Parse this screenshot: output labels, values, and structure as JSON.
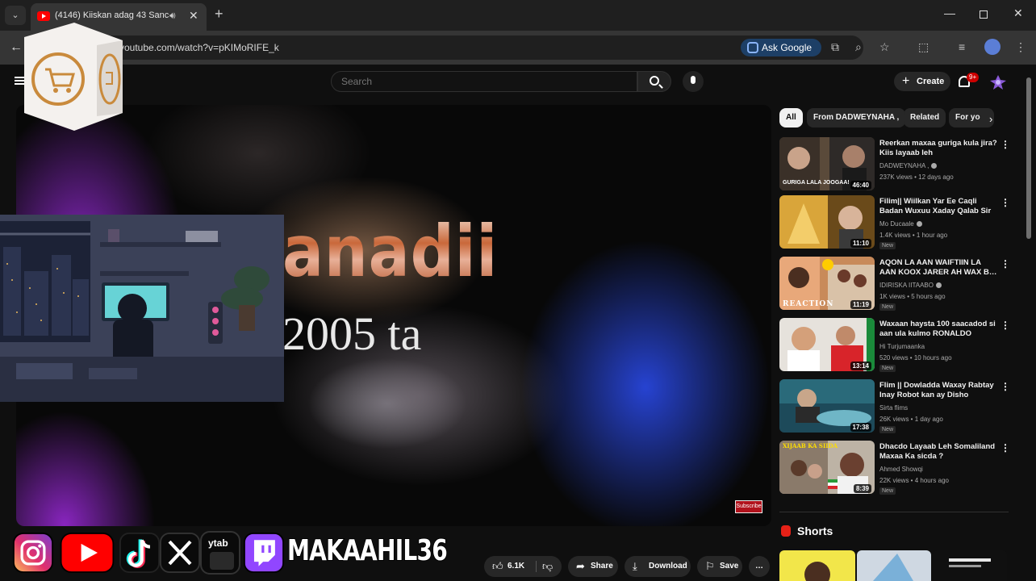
{
  "browser": {
    "tab_title": "(4146) Kiiskan adag 43 Sanc",
    "url": "youtube.com/watch?v=pKIMoRIFE_k",
    "ask_google_label": "Ask Google",
    "window_controls": [
      "minimize-icon",
      "restore-icon",
      "close-icon"
    ]
  },
  "header": {
    "search_placeholder": "Search",
    "create_label": "Create",
    "notification_badge": "9+"
  },
  "video": {
    "overlay_title": "anadii",
    "overlay_year": "2005 ta",
    "subscribe_badge": "Subscribe"
  },
  "actions": {
    "like_count": "6.1K",
    "share_label": "Share",
    "download_label": "Download",
    "save_label": "Save",
    "more_label": "…"
  },
  "social": {
    "handle": "MAKAAHIL36",
    "icons": [
      "instagram-icon",
      "youtube-icon",
      "tiktok-icon",
      "x-icon",
      "ytab-icon",
      "twitch-icon"
    ],
    "ytab_label": "ytab"
  },
  "sidebar": {
    "chips": [
      "All",
      "From DADWEYNAHA ,",
      "Related",
      "For yo"
    ],
    "recommendations": [
      {
        "title": "Reerkan maxaa guriga kula jira? Kiis layaab leh",
        "channel": "DADWEYNAHA ,",
        "verified": true,
        "meta": "237K views • 12 days ago",
        "duration": "46:40",
        "thumb_caption": "GURIGA LALA JOOGAA!",
        "is_new": false
      },
      {
        "title": "Filim|| Wiilkan Yar Ee Caqli Badan Wuxuu Xaday Qalab Sir …",
        "channel": "Mo Ducaale",
        "verified": true,
        "meta": "1.4K views • 1 hour ago",
        "duration": "11:10",
        "is_new": true
      },
      {
        "title": "AQON LA AAN WAIFTIIN LA AAN KOOX JARER AH WAX B…",
        "channel": "IDIRISKA IITAABO",
        "verified": true,
        "meta": "1K views • 5 hours ago",
        "duration": "11:19",
        "thumb_caption": "REACTION",
        "is_new": true
      },
      {
        "title": "Waxaan haysta 100 saacadod si aan ula kulmo  RONALDO",
        "channel": "Hi Turjumaanka",
        "verified": false,
        "meta": "520 views • 10 hours ago",
        "duration": "13:14",
        "is_new": true
      },
      {
        "title": "Flim || Dowladda Waxay Rabtay Inay Robot  kan ay Disho Laakii…",
        "channel": "Sirta flims",
        "verified": false,
        "meta": "26K views • 1 day ago",
        "duration": "17:38",
        "is_new": true
      },
      {
        "title": "Dhacdo Layaab Leh Somaliland Maxaa Ka sicda ?",
        "channel": "Ahmed Showqi",
        "verified": false,
        "meta": "22K views • 4 hours ago",
        "duration": "8:39",
        "thumb_caption": "XIJAAB KA SIIDA",
        "is_new": true
      }
    ],
    "new_label": "New",
    "shorts_label": "Shorts"
  },
  "colors": {
    "youtube_red": "#ff0000",
    "background": "#0f0f0f",
    "chip_bg": "#272727",
    "ask_google_bg": "#1d3f66",
    "twitch_purple": "#9146ff",
    "cart_orange": "#c98a3c"
  }
}
